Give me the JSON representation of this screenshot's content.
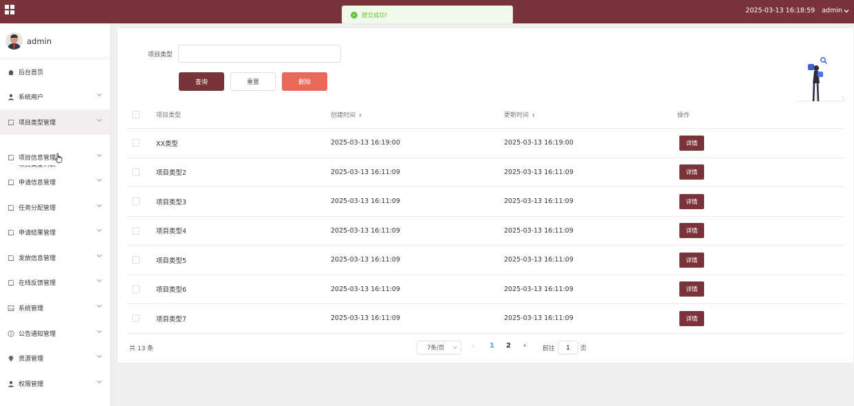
{
  "header": {
    "datetime": "2025-03-13 16:18:59",
    "user": "admin",
    "colors": {
      "brand": "#7a3338"
    }
  },
  "toast": {
    "message": "提交成功!",
    "type": "success"
  },
  "sidebar": {
    "username": "admin",
    "items": [
      {
        "label": "后台首页",
        "icon": "home-icon",
        "expandable": false
      },
      {
        "label": "系统用户",
        "icon": "user-icon",
        "expandable": true
      },
      {
        "label": "项目类型管理",
        "icon": "doc-icon",
        "expandable": true,
        "active": true
      },
      {
        "label": "项目信息管理",
        "icon": "doc-icon",
        "expandable": true
      },
      {
        "label": "申请信息管理",
        "icon": "doc-icon",
        "expandable": true
      },
      {
        "label": "任务分配管理",
        "icon": "doc-icon",
        "expandable": true
      },
      {
        "label": "申请结果管理",
        "icon": "doc-icon",
        "expandable": true
      },
      {
        "label": "发放信息管理",
        "icon": "doc-icon",
        "expandable": true
      },
      {
        "label": "在线反馈管理",
        "icon": "doc-icon",
        "expandable": true
      },
      {
        "label": "系统管理",
        "icon": "image-icon",
        "expandable": true
      },
      {
        "label": "公告通知管理",
        "icon": "info-icon",
        "expandable": true
      },
      {
        "label": "资源管理",
        "icon": "location-icon",
        "expandable": true
      },
      {
        "label": "权限管理",
        "icon": "user-icon",
        "expandable": true
      }
    ],
    "cut_submenu_label": "项目类型列表"
  },
  "search": {
    "label": "项目类型",
    "value": "",
    "placeholder": "",
    "buttons": {
      "query": "查询",
      "reset": "重置",
      "delete": "删除"
    }
  },
  "table": {
    "columns": {
      "type": "项目类型",
      "created": "创建时间",
      "updated": "更新时间",
      "op": "操作"
    },
    "rows": [
      {
        "type": "XX类型",
        "created": "2025-03-13 16:19:00",
        "updated": "2025-03-13 16:19:00",
        "action": "详情"
      },
      {
        "type": "项目类型2",
        "created": "2025-03-13 16:11:09",
        "updated": "2025-03-13 16:11:09",
        "action": "详情"
      },
      {
        "type": "项目类型3",
        "created": "2025-03-13 16:11:09",
        "updated": "2025-03-13 16:11:09",
        "action": "详情"
      },
      {
        "type": "项目类型4",
        "created": "2025-03-13 16:11:09",
        "updated": "2025-03-13 16:11:09",
        "action": "详情"
      },
      {
        "type": "项目类型5",
        "created": "2025-03-13 16:11:09",
        "updated": "2025-03-13 16:11:09",
        "action": "详情"
      },
      {
        "type": "项目类型6",
        "created": "2025-03-13 16:11:09",
        "updated": "2025-03-13 16:11:09",
        "action": "详情"
      },
      {
        "type": "项目类型7",
        "created": "2025-03-13 16:11:09",
        "updated": "2025-03-13 16:11:09",
        "action": "详情"
      }
    ]
  },
  "pagination": {
    "total": "共 13 条",
    "page_size": "7条/页",
    "pages": [
      "1",
      "2"
    ],
    "current_page": "1",
    "goto_label": "前往",
    "goto_value": "1",
    "goto_suffix": "页"
  }
}
